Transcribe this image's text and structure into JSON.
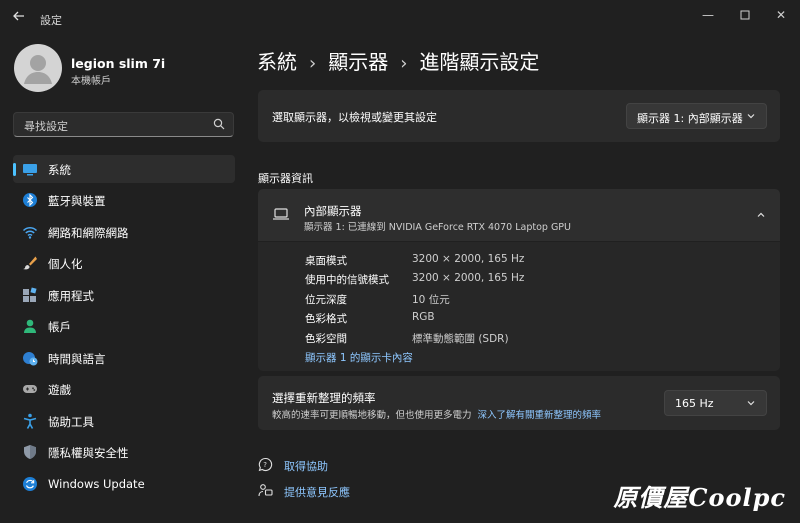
{
  "window": {
    "title": "設定"
  },
  "profile": {
    "name": "legion slim 7i",
    "account_type": "本機帳戶"
  },
  "search": {
    "placeholder": "尋找設定"
  },
  "sidebar": {
    "items": [
      {
        "label": "系統",
        "icon": "system-icon",
        "active": true
      },
      {
        "label": "藍牙與裝置",
        "icon": "bluetooth-icon"
      },
      {
        "label": "網路和網際網路",
        "icon": "wifi-icon"
      },
      {
        "label": "個人化",
        "icon": "brush-icon"
      },
      {
        "label": "應用程式",
        "icon": "apps-icon"
      },
      {
        "label": "帳戶",
        "icon": "person-icon"
      },
      {
        "label": "時間與語言",
        "icon": "globe-clock-icon"
      },
      {
        "label": "遊戲",
        "icon": "gamepad-icon"
      },
      {
        "label": "協助工具",
        "icon": "accessibility-icon"
      },
      {
        "label": "隱私權與安全性",
        "icon": "shield-icon"
      },
      {
        "label": "Windows Update",
        "icon": "update-icon"
      }
    ]
  },
  "breadcrumb": [
    "系統",
    "顯示器",
    "進階顯示設定"
  ],
  "display_select": {
    "label": "選取顯示器，以檢視或變更其設定",
    "value": "顯示器 1: 內部顯示器"
  },
  "display_info": {
    "section_title": "顯示器資訊",
    "name": "內部顯示器",
    "subtitle": "顯示器 1: 已連線到 NVIDIA GeForce RTX 4070 Laptop GPU",
    "rows": [
      {
        "key": "桌面模式",
        "value": "3200 × 2000, 165 Hz"
      },
      {
        "key": "使用中的信號模式",
        "value": "3200 × 2000, 165 Hz"
      },
      {
        "key": "位元深度",
        "value": "10 位元"
      },
      {
        "key": "色彩格式",
        "value": "RGB"
      },
      {
        "key": "色彩空間",
        "value": "標準動態範圍 (SDR)"
      }
    ],
    "adapter_link": "顯示器 1 的顯示卡內容"
  },
  "refresh": {
    "title": "選擇重新整理的頻率",
    "description": "較高的速率可更順暢地移動，但也使用更多電力",
    "learn_more": "深入了解有關重新整理的頻率",
    "value": "165 Hz"
  },
  "footer": {
    "help": "取得協助",
    "feedback": "提供意見反應"
  },
  "watermark": "原價屋Coolpc",
  "colors": {
    "accent": "#4cc2ff",
    "link": "#8ec7ff",
    "background": "#202020",
    "card": "#2b2b2b"
  }
}
